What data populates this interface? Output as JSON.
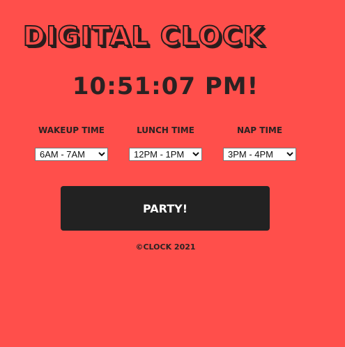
{
  "title": "DIGITAL CLOCK",
  "clock": {
    "time": "10:51:07 PM!"
  },
  "schedule": {
    "wakeup": {
      "label": "WAKEUP TIME",
      "selected": "6AM - 7AM"
    },
    "lunch": {
      "label": "LUNCH TIME",
      "selected": "12PM - 1PM"
    },
    "nap": {
      "label": "NAP TIME",
      "selected": "3PM - 4PM"
    }
  },
  "party_button": {
    "label": "PARTY!"
  },
  "footer": {
    "text": "©CLOCK 2021"
  },
  "colors": {
    "background": "#ff4f4b",
    "dark": "#222222",
    "button_text": "#ffffff"
  }
}
